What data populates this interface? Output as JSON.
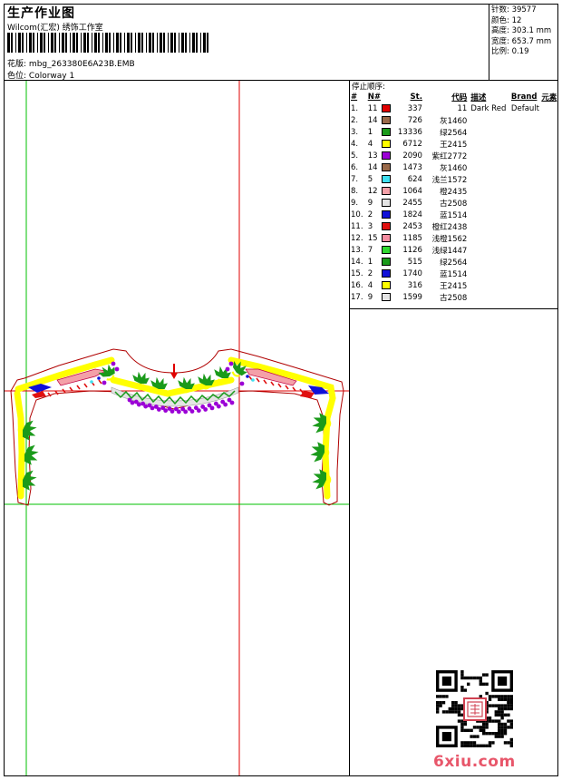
{
  "header": {
    "title": "生产作业图",
    "company": "Wilcom(汇宏) 绣饰工作室",
    "pattern_label": "花版:",
    "pattern_value": "mbg_263380E6A23B.EMB",
    "colorway_label": "色位:",
    "colorway_value": "Colorway 1"
  },
  "stats": {
    "stitches": "针数: 39577",
    "colors": "颜色: 12",
    "height": "高度: 303.1 mm",
    "width": "宽度: 653.7 mm",
    "scale": "比例: 0.19"
  },
  "stop_sequence": {
    "title": "停止顺序:",
    "headers": [
      "#",
      "N#",
      "St.",
      "代码",
      "描述",
      "Brand",
      "元素"
    ],
    "rows": [
      {
        "idx": "1.",
        "n": "11",
        "st": "337",
        "code": "11",
        "desc": "Dark Red",
        "brand": "Default",
        "color": "#e00000"
      },
      {
        "idx": "2.",
        "n": "14",
        "st": "726",
        "code": "灰1460",
        "desc": "",
        "brand": "",
        "color": "#9a6a4a"
      },
      {
        "idx": "3.",
        "n": "1",
        "st": "13336",
        "code": "绿2564",
        "desc": "",
        "brand": "",
        "color": "#1a9a1a"
      },
      {
        "idx": "4.",
        "n": "4",
        "st": "6712",
        "code": "王2415",
        "desc": "",
        "brand": "",
        "color": "#ffff00"
      },
      {
        "idx": "5.",
        "n": "13",
        "st": "2090",
        "code": "紫红2772",
        "desc": "",
        "brand": "",
        "color": "#9b00d6"
      },
      {
        "idx": "6.",
        "n": "14",
        "st": "1473",
        "code": "灰1460",
        "desc": "",
        "brand": "",
        "color": "#9a6a4a"
      },
      {
        "idx": "7.",
        "n": "5",
        "st": "624",
        "code": "浅兰1572",
        "desc": "",
        "brand": "",
        "color": "#40e0f0"
      },
      {
        "idx": "8.",
        "n": "12",
        "st": "1064",
        "code": "橙2435",
        "desc": "",
        "brand": "",
        "color": "#f4a0a8"
      },
      {
        "idx": "9.",
        "n": "9",
        "st": "2455",
        "code": "古2508",
        "desc": "",
        "brand": "",
        "color": "#e4e4e4"
      },
      {
        "idx": "10.",
        "n": "2",
        "st": "1824",
        "code": "蓝1514",
        "desc": "",
        "brand": "",
        "color": "#1010d8"
      },
      {
        "idx": "11.",
        "n": "3",
        "st": "2453",
        "code": "橙红2438",
        "desc": "",
        "brand": "",
        "color": "#e01010"
      },
      {
        "idx": "12.",
        "n": "15",
        "st": "1185",
        "code": "浅橙1562",
        "desc": "",
        "brand": "",
        "color": "#f48ca0"
      },
      {
        "idx": "13.",
        "n": "7",
        "st": "1126",
        "code": "浅绿1447",
        "desc": "",
        "brand": "",
        "color": "#30d830"
      },
      {
        "idx": "14.",
        "n": "1",
        "st": "515",
        "code": "绿2564",
        "desc": "",
        "brand": "",
        "color": "#1a9a1a"
      },
      {
        "idx": "15.",
        "n": "2",
        "st": "1740",
        "code": "蓝1514",
        "desc": "",
        "brand": "",
        "color": "#1010d8"
      },
      {
        "idx": "16.",
        "n": "4",
        "st": "316",
        "code": "王2415",
        "desc": "",
        "brand": "",
        "color": "#ffff00"
      },
      {
        "idx": "17.",
        "n": "9",
        "st": "1599",
        "code": "古2508",
        "desc": "",
        "brand": "",
        "color": "#e4e4e4"
      }
    ]
  },
  "watermark": "6xiu.com",
  "icons": {
    "barcode": "barcode-icon",
    "qr": "qr-code-icon",
    "seal": "seal-icon"
  }
}
